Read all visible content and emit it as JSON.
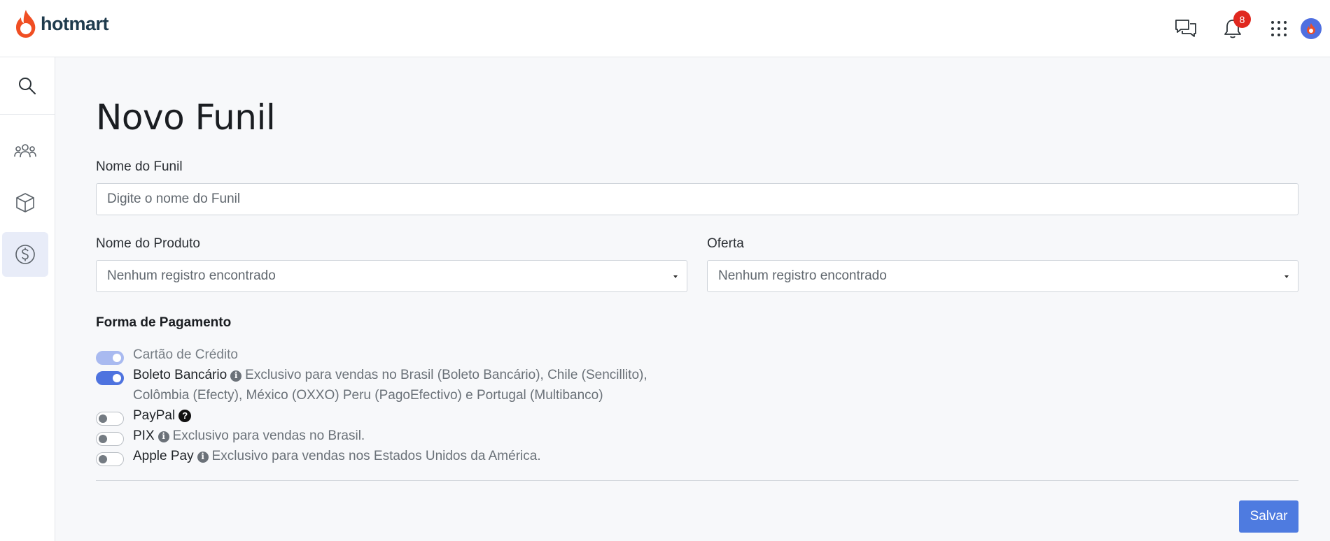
{
  "header": {
    "brand": "hotmart",
    "notifications_count": "8",
    "icons": [
      "chat-icon",
      "bell-icon",
      "apps-grid-icon",
      "avatar"
    ]
  },
  "sidebar": {
    "items": [
      {
        "name": "search-icon"
      },
      {
        "name": "users-icon"
      },
      {
        "name": "box-icon"
      },
      {
        "name": "dollar-icon",
        "active": true
      }
    ]
  },
  "page": {
    "title": "Novo Funil"
  },
  "form": {
    "funnel_name_label": "Nome do Funil",
    "funnel_name_placeholder": "Digite o nome do Funil",
    "product_label": "Nome do Produto",
    "product_value": "Nenhum registro encontrado",
    "offer_label": "Oferta",
    "offer_value": "Nenhum registro encontrado",
    "payment_section_title": "Forma de Pagamento",
    "payments": [
      {
        "label": "Cartão de Crédito",
        "state": "disabled-on",
        "note": ""
      },
      {
        "label": "Boleto Bancário",
        "state": "on",
        "note_line1": "Exclusivo para vendas no Brasil (Boleto Bancário), Chile (Sencillito),",
        "note_line2": "Colômbia (Efecty), México (OXXO) Peru (PagoEfectivo) e Portugal (Multibanco)"
      },
      {
        "label": "PayPal",
        "state": "off",
        "note": ""
      },
      {
        "label": "PIX",
        "state": "off",
        "note": "Exclusivo para vendas no Brasil."
      },
      {
        "label": "Apple Pay",
        "state": "off",
        "note": "Exclusivo para vendas nos Estados Unidos da América."
      }
    ],
    "save_label": "Salvar"
  },
  "colors": {
    "accent": "#4e7be0",
    "badge": "#e0281f",
    "brand_flame": "#f04e23"
  }
}
